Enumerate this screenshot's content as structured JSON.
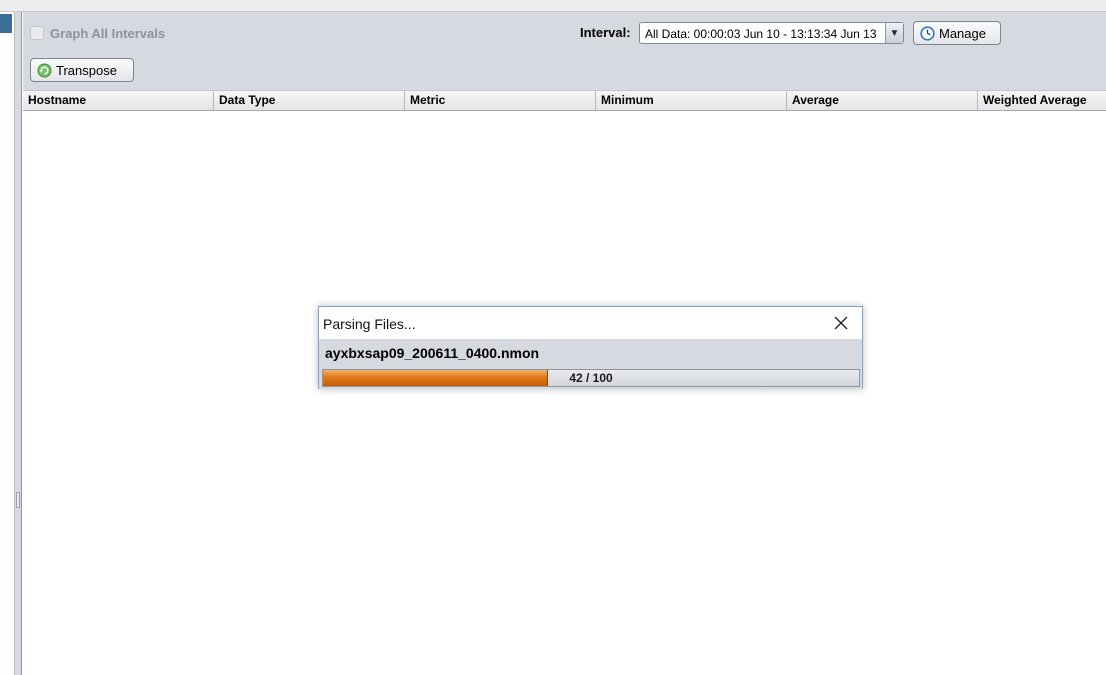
{
  "controls": {
    "graph_all_intervals_label": "Graph All Intervals",
    "graph_all_intervals_checked": false,
    "interval_label": "Interval:",
    "interval_value": "All Data: 00:00:03 Jun 10 - 13:13:34 Jun 13",
    "manage_label": "Manage",
    "transpose_label": "Transpose"
  },
  "table": {
    "columns": [
      "Hostname",
      "Data Type",
      "Metric",
      "Minimum",
      "Average",
      "Weighted Average"
    ],
    "rows": []
  },
  "dialog": {
    "title": "Parsing Files...",
    "file": "ayxbxsap09_200611_0400.nmon",
    "progress_text": "42 / 100",
    "progress_fraction": 0.42
  },
  "colors": {
    "panel": "#d6d9df",
    "progress_fill": "#e07818",
    "left_tab": "#3a6e96"
  },
  "icons": {
    "manage": "clock-icon",
    "transpose": "refresh-icon",
    "close": "close-icon",
    "dropdown": "chevron-down-icon"
  }
}
